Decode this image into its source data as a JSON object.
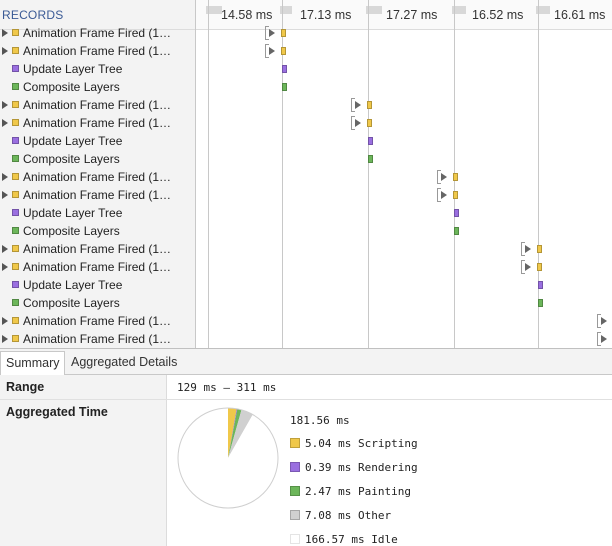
{
  "records": {
    "header": "RECORDS",
    "items": [
      {
        "label": "Animation Frame Fired (1…",
        "type": "scripting",
        "expandable": true
      },
      {
        "label": "Animation Frame Fired (1…",
        "type": "scripting",
        "expandable": true
      },
      {
        "label": "Update Layer Tree",
        "type": "rendering",
        "expandable": false
      },
      {
        "label": "Composite Layers",
        "type": "painting",
        "expandable": false
      },
      {
        "label": "Animation Frame Fired (1…",
        "type": "scripting",
        "expandable": true
      },
      {
        "label": "Animation Frame Fired (1…",
        "type": "scripting",
        "expandable": true
      },
      {
        "label": "Update Layer Tree",
        "type": "rendering",
        "expandable": false
      },
      {
        "label": "Composite Layers",
        "type": "painting",
        "expandable": false
      },
      {
        "label": "Animation Frame Fired (1…",
        "type": "scripting",
        "expandable": true
      },
      {
        "label": "Animation Frame Fired (1…",
        "type": "scripting",
        "expandable": true
      },
      {
        "label": "Update Layer Tree",
        "type": "rendering",
        "expandable": false
      },
      {
        "label": "Composite Layers",
        "type": "painting",
        "expandable": false
      },
      {
        "label": "Animation Frame Fired (1…",
        "type": "scripting",
        "expandable": true
      },
      {
        "label": "Animation Frame Fired (1…",
        "type": "scripting",
        "expandable": true
      },
      {
        "label": "Update Layer Tree",
        "type": "rendering",
        "expandable": false
      },
      {
        "label": "Composite Layers",
        "type": "painting",
        "expandable": false
      },
      {
        "label": "Animation Frame Fired (1…",
        "type": "scripting",
        "expandable": true
      },
      {
        "label": "Animation Frame Fired (1…",
        "type": "scripting",
        "expandable": true
      }
    ]
  },
  "frames": [
    "14.58 ms",
    "17.13 ms",
    "17.27 ms",
    "16.52 ms",
    "16.61 ms"
  ],
  "tabs": [
    {
      "label": "Summary",
      "active": true
    },
    {
      "label": "Aggregated Details",
      "active": false
    }
  ],
  "summary": {
    "range_label": "Range",
    "range_value": "129 ms – 311 ms",
    "aggregated_label": "Aggregated Time",
    "total": "181.56 ms",
    "legend": [
      {
        "label": "5.04 ms Scripting",
        "value": 5.04,
        "color": "#f0c84a"
      },
      {
        "label": "0.39 ms Rendering",
        "value": 0.39,
        "color": "#9a6fe0"
      },
      {
        "label": "2.47 ms Painting",
        "value": 2.47,
        "color": "#6cb65a"
      },
      {
        "label": "7.08 ms Other",
        "value": 7.08,
        "color": "#d0d0d0"
      },
      {
        "label": "166.57 ms Idle",
        "value": 166.57,
        "color": "#ffffff"
      }
    ]
  },
  "colors": {
    "scripting": "#f0c84a",
    "rendering": "#9a6fe0",
    "painting": "#6cb65a",
    "header_text": "#3a5a95"
  }
}
